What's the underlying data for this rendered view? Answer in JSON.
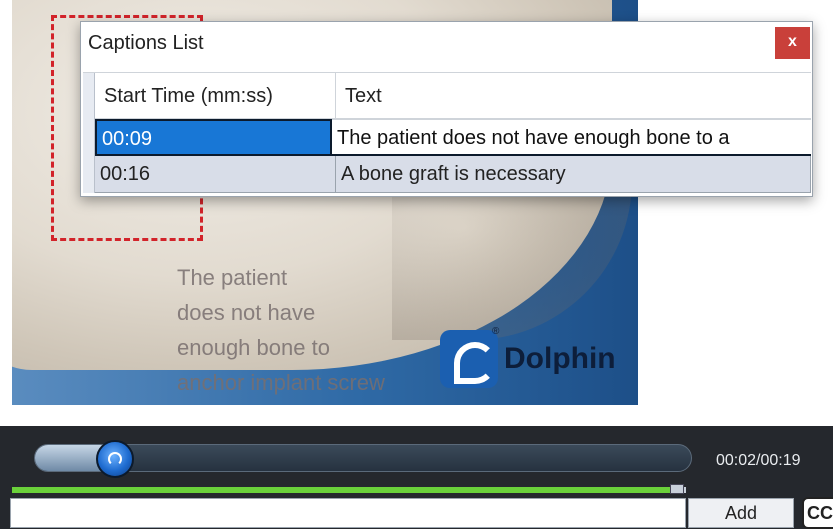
{
  "video": {
    "overlay_caption": "The patient\ndoes not have\nenough bone to\nanchor implant screw",
    "brand": "Dolphin",
    "brand_mark": "®"
  },
  "captions_dialog": {
    "title": "Captions List",
    "close_label": "x",
    "columns": [
      "Start Time (mm:ss)",
      "Text"
    ],
    "rows": [
      {
        "start_time": "00:09",
        "text": "The patient does not have enough bone to a",
        "selected": true
      },
      {
        "start_time": "00:16",
        "text": "A bone graft is necessary",
        "selected": false
      }
    ]
  },
  "player": {
    "time_readout": "00:02/00:19",
    "progress": 0.1,
    "caption_input": {
      "value": "",
      "placeholder": ""
    },
    "add_label": "Add",
    "cc_label": "CC"
  },
  "colors": {
    "selection": "#1877d6",
    "close_button": "#c9403a",
    "player_background": "#25282d",
    "caption_track_fill": "#6ad13a"
  }
}
